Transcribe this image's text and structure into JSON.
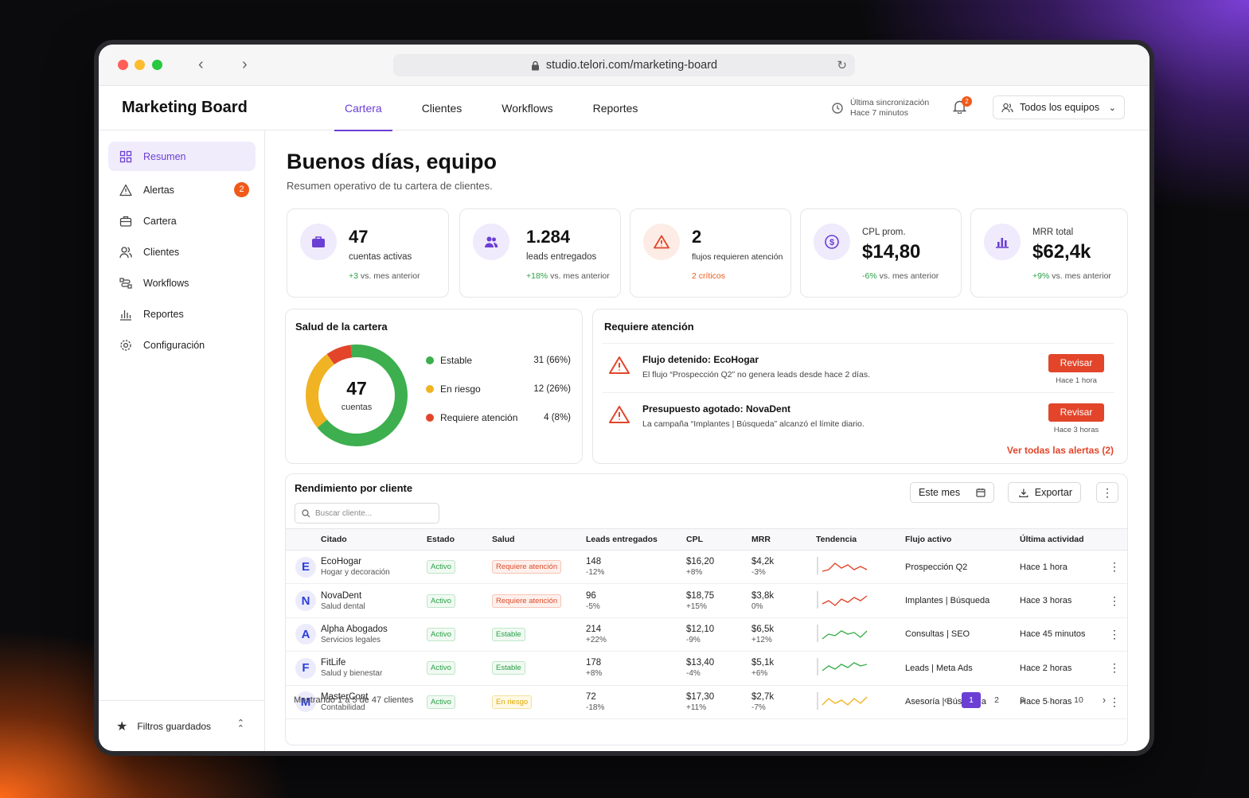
{
  "browser": {
    "url": "studio.telori.com/marketing-board"
  },
  "header": {
    "brand": "Marketing Board",
    "tabs": [
      "Cartera",
      "Clientes",
      "Workflows",
      "Reportes"
    ],
    "sync_label": "Última sincronización",
    "sync_time": "Hace 7 minutos",
    "notif_count": "2",
    "team_select": "Todos los equipos"
  },
  "sidebar": {
    "items": [
      {
        "label": "Resumen",
        "icon": "grid-icon"
      },
      {
        "label": "Alertas",
        "icon": "warning-icon",
        "badge": "2"
      },
      {
        "label": "Cartera",
        "icon": "briefcase-icon"
      },
      {
        "label": "Clientes",
        "icon": "users-icon"
      },
      {
        "label": "Workflows",
        "icon": "workflow-icon"
      },
      {
        "label": "Reportes",
        "icon": "bar-chart-icon"
      },
      {
        "label": "Configuración",
        "icon": "gear-icon"
      }
    ],
    "footer": "Filtros guardados"
  },
  "greeting": {
    "title": "Buenos días, equipo",
    "subtitle": "Resumen operativo de tu cartera de clientes."
  },
  "kpis": [
    {
      "value": "47",
      "label": "cuentas activas",
      "delta": "+3",
      "delta_rest": " vs. mes anterior"
    },
    {
      "value": "1.284",
      "label": "leads entregados",
      "delta": "+18%",
      "delta_rest": " vs. mes anterior"
    },
    {
      "value": "2",
      "label": "flujos requieren atención",
      "delta": "2 críticos",
      "delta_rest": ""
    },
    {
      "value": "$14,80",
      "label": "CPL prom.",
      "delta": "-6%",
      "delta_rest": " vs. mes anterior"
    },
    {
      "value": "$62,4k",
      "label": "MRR total",
      "delta": "+9%",
      "delta_rest": " vs. mes anterior"
    }
  ],
  "health": {
    "title": "Salud de la cartera",
    "total": "47",
    "total_label": "cuentas",
    "segments": [
      {
        "label": "Estable",
        "value": "31 (66%)",
        "share": 0.66,
        "color": "#3daf4e"
      },
      {
        "label": "En riesgo",
        "value": "12 (26%)",
        "share": 0.26,
        "color": "#f0b323"
      },
      {
        "label": "Requiere atención",
        "value": "4 (8%)",
        "share": 0.08,
        "color": "#e2452a"
      }
    ]
  },
  "attention": {
    "title": "Requiere atención",
    "alerts": [
      {
        "title": "Flujo detenido: EcoHogar",
        "desc": "El flujo “Prospección Q2” no genera leads desde hace 2 días.",
        "button": "Revisar",
        "time": "Hace 1 hora"
      },
      {
        "title": "Presupuesto agotado: NovaDent",
        "desc": "La campaña “Implantes | Búsqueda” alcanzó el límite diario.",
        "button": "Revisar",
        "time": "Hace 3 horas"
      }
    ],
    "view_all": "Ver todas las alertas (2)"
  },
  "performance": {
    "title": "Rendimiento por cliente",
    "period": "Este mes",
    "export": "Exportar",
    "search_placeholder": "Buscar cliente...",
    "columns": [
      "Citado",
      "Estado",
      "Salud",
      "Leads entregados",
      "CPL",
      "MRR",
      "Tendencia",
      "Flujo activo",
      "Última actividad"
    ],
    "rows": [
      {
        "initial": "E",
        "name": "EcoHogar",
        "sector": "Hogar y decoración",
        "status": "Activo",
        "health": "Requiere atención",
        "leads": "148",
        "leads_d": "-12%",
        "cpl": "$16,20",
        "cpl_d": "+8%",
        "mrr": "$4,2k",
        "mrr_d": "-3%",
        "flow": "Prospección Q2",
        "last": "Hace 1 hora"
      },
      {
        "initial": "N",
        "name": "NovaDent",
        "sector": "Salud dental",
        "status": "Activo",
        "health": "Requiere atención",
        "leads": "96",
        "leads_d": "-5%",
        "cpl": "$18,75",
        "cpl_d": "+15%",
        "mrr": "$3,8k",
        "mrr_d": "0%",
        "flow": "Implantes | Búsqueda",
        "last": "Hace 3 horas"
      },
      {
        "initial": "A",
        "name": "Alpha Abogados",
        "sector": "Servicios legales",
        "status": "Activo",
        "health": "Estable",
        "leads": "214",
        "leads_d": "+22%",
        "cpl": "$12,10",
        "cpl_d": "-9%",
        "mrr": "$6,5k",
        "mrr_d": "+12%",
        "flow": "Consultas | SEO",
        "last": "Hace 45 minutos"
      },
      {
        "initial": "F",
        "name": "FitLife",
        "sector": "Salud y bienestar",
        "status": "Activo",
        "health": "Estable",
        "leads": "178",
        "leads_d": "+8%",
        "cpl": "$13,40",
        "cpl_d": "-4%",
        "mrr": "$5,1k",
        "mrr_d": "+6%",
        "flow": "Leads | Meta Ads",
        "last": "Hace 2 horas"
      },
      {
        "initial": "M",
        "name": "MasterCont",
        "sector": "Contabilidad",
        "status": "Activo",
        "health": "En riesgo",
        "leads": "72",
        "leads_d": "-18%",
        "cpl": "$17,30",
        "cpl_d": "+11%",
        "mrr": "$2,7k",
        "mrr_d": "-7%",
        "flow": "Asesoría | Búsqueda",
        "last": "Hace 5 horas"
      }
    ],
    "footer": "Mostrando 1 a 5 de 47 clientes",
    "pages": [
      "1",
      "2",
      "3",
      "...",
      "10"
    ]
  }
}
